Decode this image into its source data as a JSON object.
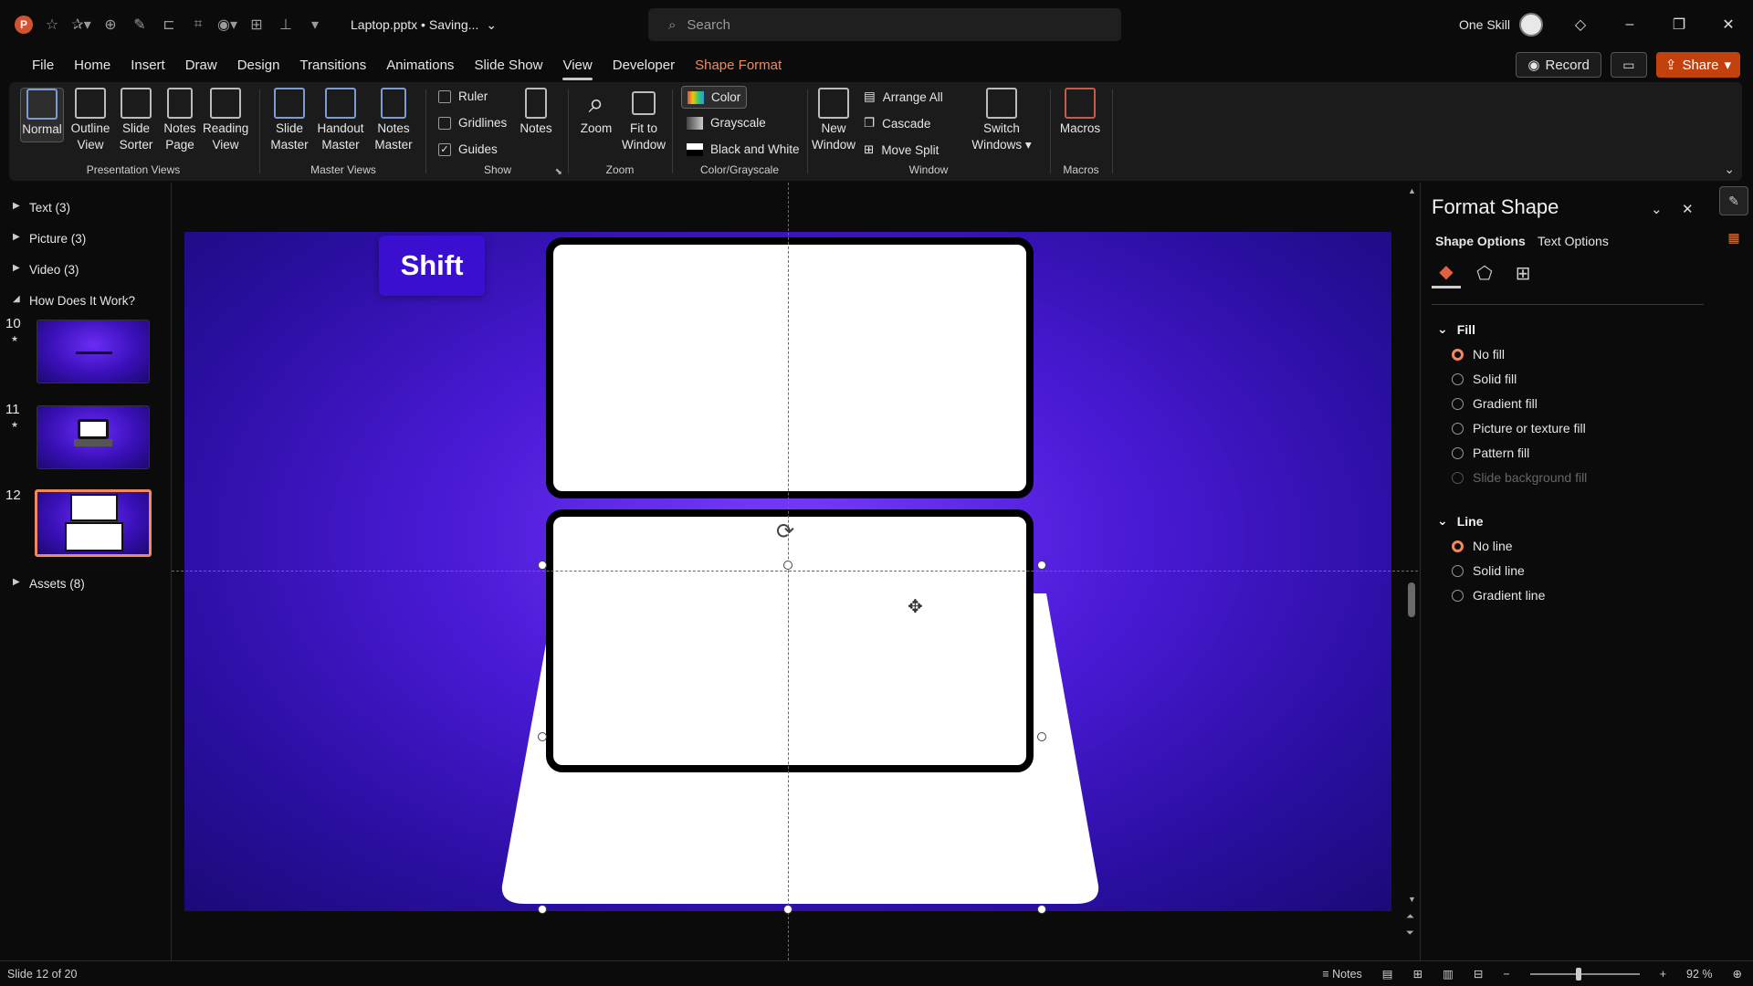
{
  "app": {
    "title": "Laptop.pptx • Saving...",
    "user_name": "One Skill"
  },
  "search": {
    "placeholder": "Search"
  },
  "ribbon_tabs": [
    "File",
    "Home",
    "Insert",
    "Draw",
    "Design",
    "Transitions",
    "Animations",
    "Slide Show",
    "View",
    "Developer",
    "Shape Format"
  ],
  "actions": {
    "record": "Record",
    "share": "Share"
  },
  "ribbon": {
    "presentation_views": {
      "label": "Presentation Views",
      "normal": "Normal",
      "outline": "Outline View",
      "sorter": "Slide Sorter",
      "notes_page": "Notes Page",
      "reading": "Reading View"
    },
    "master_views": {
      "label": "Master Views",
      "slide_master": "Slide Master",
      "handout_master": "Handout Master",
      "notes_master": "Notes Master"
    },
    "show": {
      "label": "Show",
      "ruler": "Ruler",
      "gridlines": "Gridlines",
      "guides": "Guides",
      "notes": "Notes"
    },
    "zoom": {
      "label": "Zoom",
      "zoom": "Zoom",
      "fit": "Fit to Window"
    },
    "color": {
      "label": "Color/Grayscale",
      "color": "Color",
      "grayscale": "Grayscale",
      "bw": "Black and White"
    },
    "window": {
      "label": "Window",
      "new_window": "New Window",
      "arrange_all": "Arrange All",
      "cascade": "Cascade",
      "move_split": "Move Split",
      "switch": "Switch Windows"
    },
    "macros": {
      "label": "Macros",
      "macros": "Macros"
    }
  },
  "slide_pane": {
    "sections": {
      "text": "Text (3)",
      "picture": "Picture (3)",
      "video": "Video (3)",
      "how": "How Does It Work?",
      "assets": "Assets (8)"
    },
    "slides": [
      {
        "number": "10"
      },
      {
        "number": "11"
      },
      {
        "number": "12"
      }
    ]
  },
  "slide": {
    "label": "Shift"
  },
  "format_pane": {
    "title": "Format Shape",
    "tabs": {
      "shape": "Shape Options",
      "text": "Text Options"
    },
    "fill": {
      "header": "Fill",
      "options": [
        "No fill",
        "Solid fill",
        "Gradient fill",
        "Picture or texture fill",
        "Pattern fill",
        "Slide background fill"
      ]
    },
    "line": {
      "header": "Line",
      "options": [
        "No line",
        "Solid line",
        "Gradient line"
      ]
    }
  },
  "status": {
    "slide_info": "Slide 12 of 20",
    "notes": "Notes",
    "zoom": "92 %"
  },
  "colors": {
    "accent": "#f08a5d",
    "share": "#c2410c",
    "slide_bg": "#4a1ad6"
  }
}
